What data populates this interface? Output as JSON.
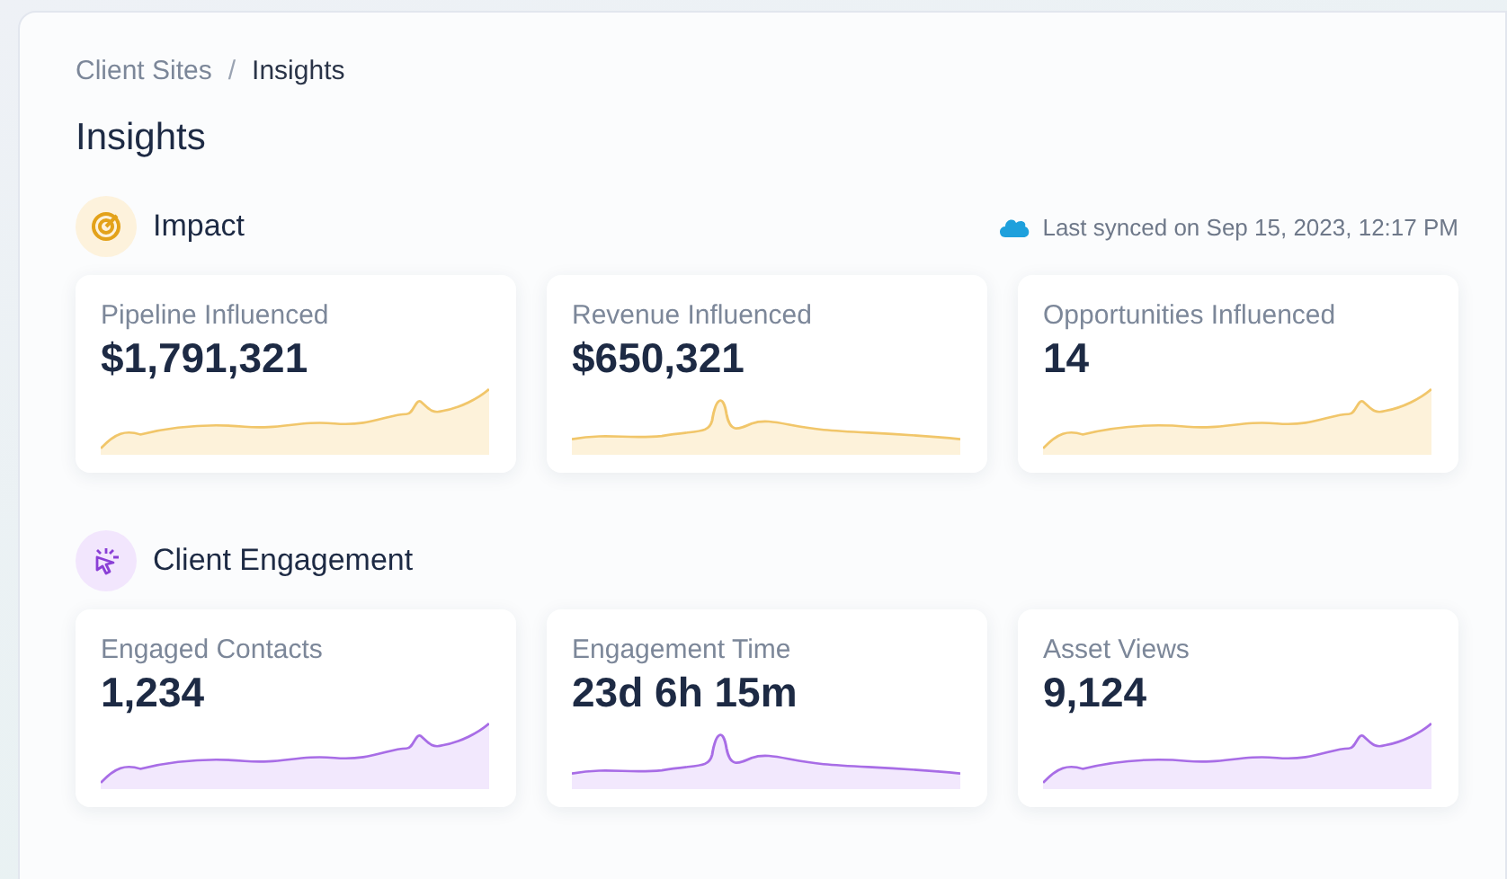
{
  "breadcrumb": [
    {
      "label": "Client Sites",
      "current": false
    },
    {
      "label": "Insights",
      "current": true
    }
  ],
  "breadcrumb_separator": "/",
  "title": "Insights",
  "sections": [
    {
      "title": "Impact",
      "kind": "target",
      "sync": "Last synced on Sep 15, 2023, 12:17 PM",
      "cards": [
        {
          "label": "Pipeline Influenced",
          "value": "$1,791,321",
          "kind": "rising"
        },
        {
          "label": "Revenue Influenced",
          "value": "$650,321",
          "kind": "spike"
        },
        {
          "label": "Opportunities Influenced",
          "value": "14",
          "kind": "rising"
        }
      ]
    },
    {
      "title": "Client Engagement",
      "kind": "click",
      "cards": [
        {
          "label": "Engaged Contacts",
          "value": "1,234",
          "kind": "rising"
        },
        {
          "label": "Engagement Time",
          "value": "23d 6h 15m",
          "kind": "spike"
        },
        {
          "label": "Asset Views",
          "value": "9,124",
          "kind": "rising"
        }
      ]
    }
  ]
}
